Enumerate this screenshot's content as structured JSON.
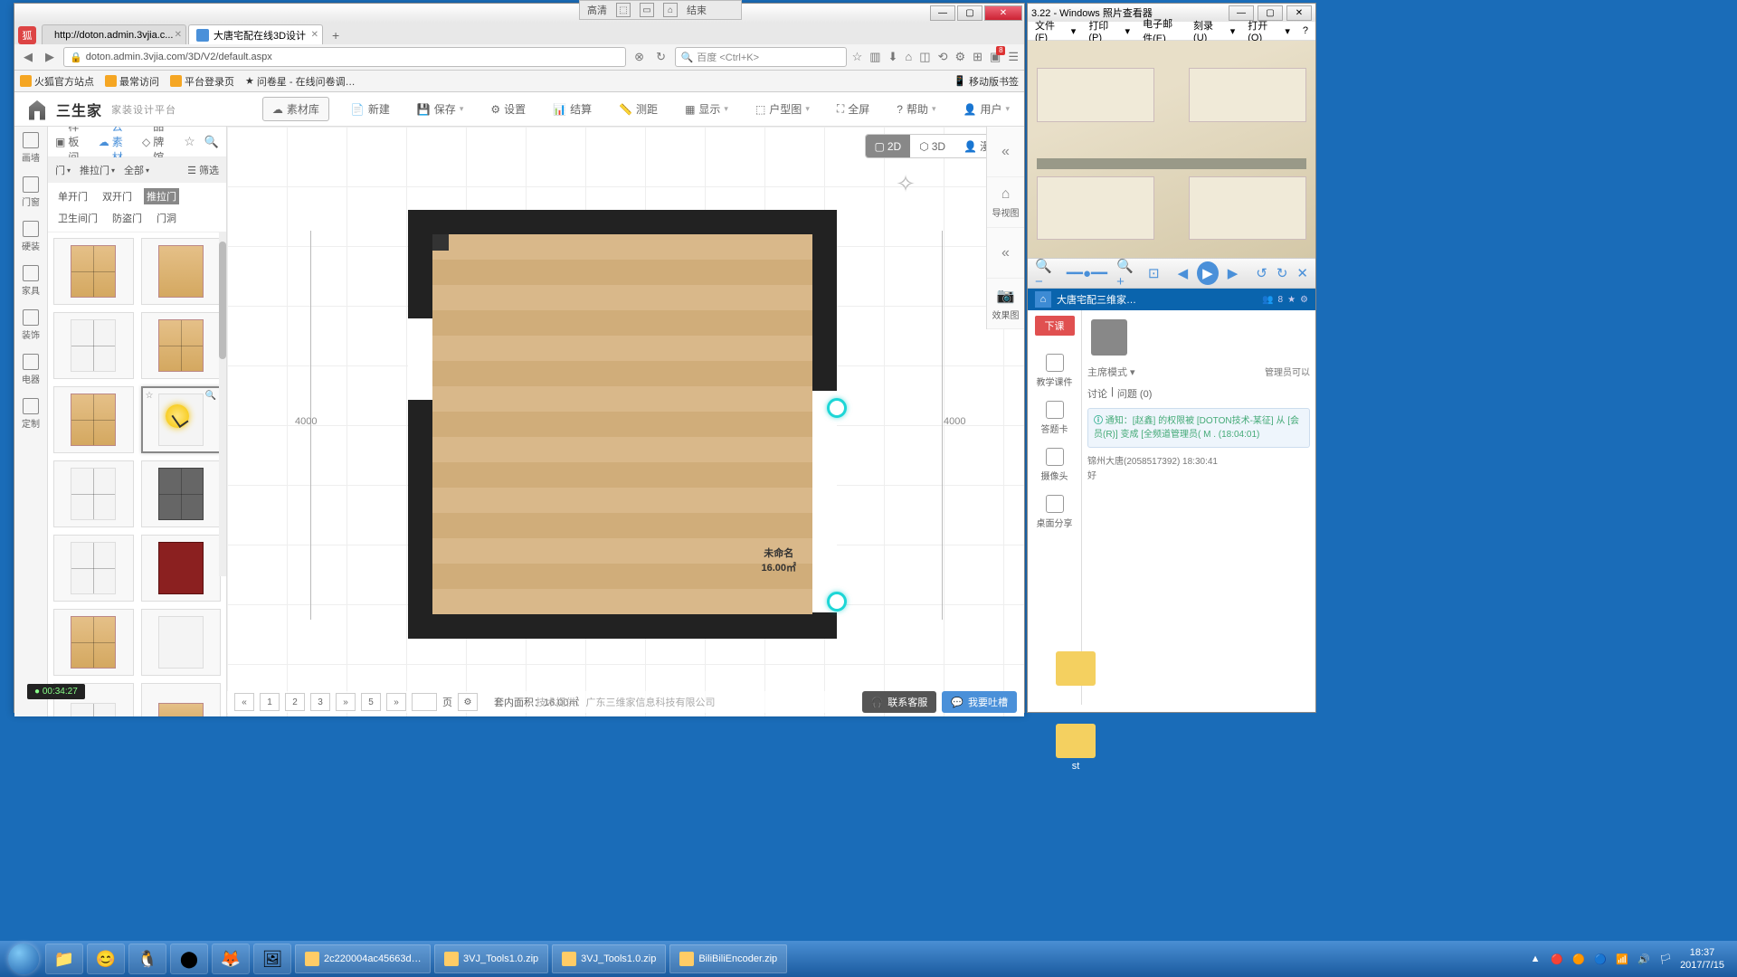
{
  "screencast": {
    "left": "高清",
    "right": "结束"
  },
  "browser": {
    "tabs": [
      {
        "title": "http://doton.admin.3vjia.c..."
      },
      {
        "title": "大唐宅配在线3D设计"
      }
    ],
    "url": "doton.admin.3vjia.com/3D/V2/default.aspx",
    "search_placeholder": "百度 <Ctrl+K>",
    "bookmarks": [
      "火狐官方站点",
      "最常访问",
      "平台登录页",
      "问卷星 - 在线问卷调…"
    ],
    "bookmark_right": "移动版书签"
  },
  "app": {
    "logo": "三生家",
    "logo_sub": "家装设计平台",
    "toolbar": {
      "lib": "素材库",
      "new": "新建",
      "save": "保存",
      "settings": "设置",
      "checkout": "结算",
      "measure": "测距",
      "display": "显示",
      "plan": "户型图",
      "fullscreen": "全屏",
      "help": "帮助",
      "user": "用户"
    },
    "rail": [
      "画墙",
      "门窗",
      "硬装",
      "家具",
      "装饰",
      "电器",
      "定制"
    ],
    "panel": {
      "tabs": {
        "sample": "样板间",
        "cloud": "云素材",
        "brand": "品牌馆"
      },
      "filters": {
        "door": "门",
        "slide": "推拉门",
        "all": "全部",
        "filter": "筛选"
      },
      "door_types": [
        "单开门",
        "双开门",
        "推拉门",
        "卫生间门",
        "防盗门",
        "门洞"
      ]
    },
    "view": {
      "v2d": "2D",
      "v3d": "3D",
      "roam": "漫游"
    },
    "side_tools": {
      "nav": "导视图",
      "effect": "效果图"
    },
    "room": {
      "name": "未命名",
      "area": "16.00㎡"
    },
    "ruler": {
      "left": "4000",
      "right": "4000"
    },
    "footer": {
      "pages": [
        "1",
        "2",
        "3"
      ],
      "page_input": "5",
      "page_unit": "页",
      "area_label": "套内面积：",
      "area_value": "16.00㎡",
      "provider": "技术提供：广东三维家信息科技有限公司",
      "contact": "联系客服",
      "feedback": "我要吐槽"
    }
  },
  "photoviewer": {
    "title": "3.22 - Windows 照片查看器",
    "menu": [
      "文件(F)",
      "打印(P)",
      "电子邮件(E)",
      "刻录(U)",
      "打开(O)"
    ],
    "blue_title": "大唐宅配三维家…",
    "badge": "8",
    "red_btn": "下课",
    "left_btns": [
      "教学课件",
      "答题卡",
      "摄像头",
      "桌面分享"
    ],
    "mode_label": "主席模式",
    "mgr_label": "管理员可以",
    "tabs": {
      "discuss": "讨论",
      "question": "问题 (0)"
    },
    "notice": "通知：[赵鑫] 的权限被 [DOTON技术-某征] 从 [会员(R)] 变成 [全频道管理员( M .  (18:04:01)",
    "chat_user": "锦州大唐(2058517392) 18:30:41",
    "chat_msg": "好"
  },
  "status_timer": "00:34:27",
  "desktop": {
    "st": "st"
  },
  "taskbar": {
    "tasks": [
      "2c220004ac45663d…",
      "3VJ_Tools1.0.zip",
      "3VJ_Tools1.0.zip",
      "BiliBiliEncoder.zip"
    ],
    "time": "18:37",
    "date": "2017/7/15"
  }
}
